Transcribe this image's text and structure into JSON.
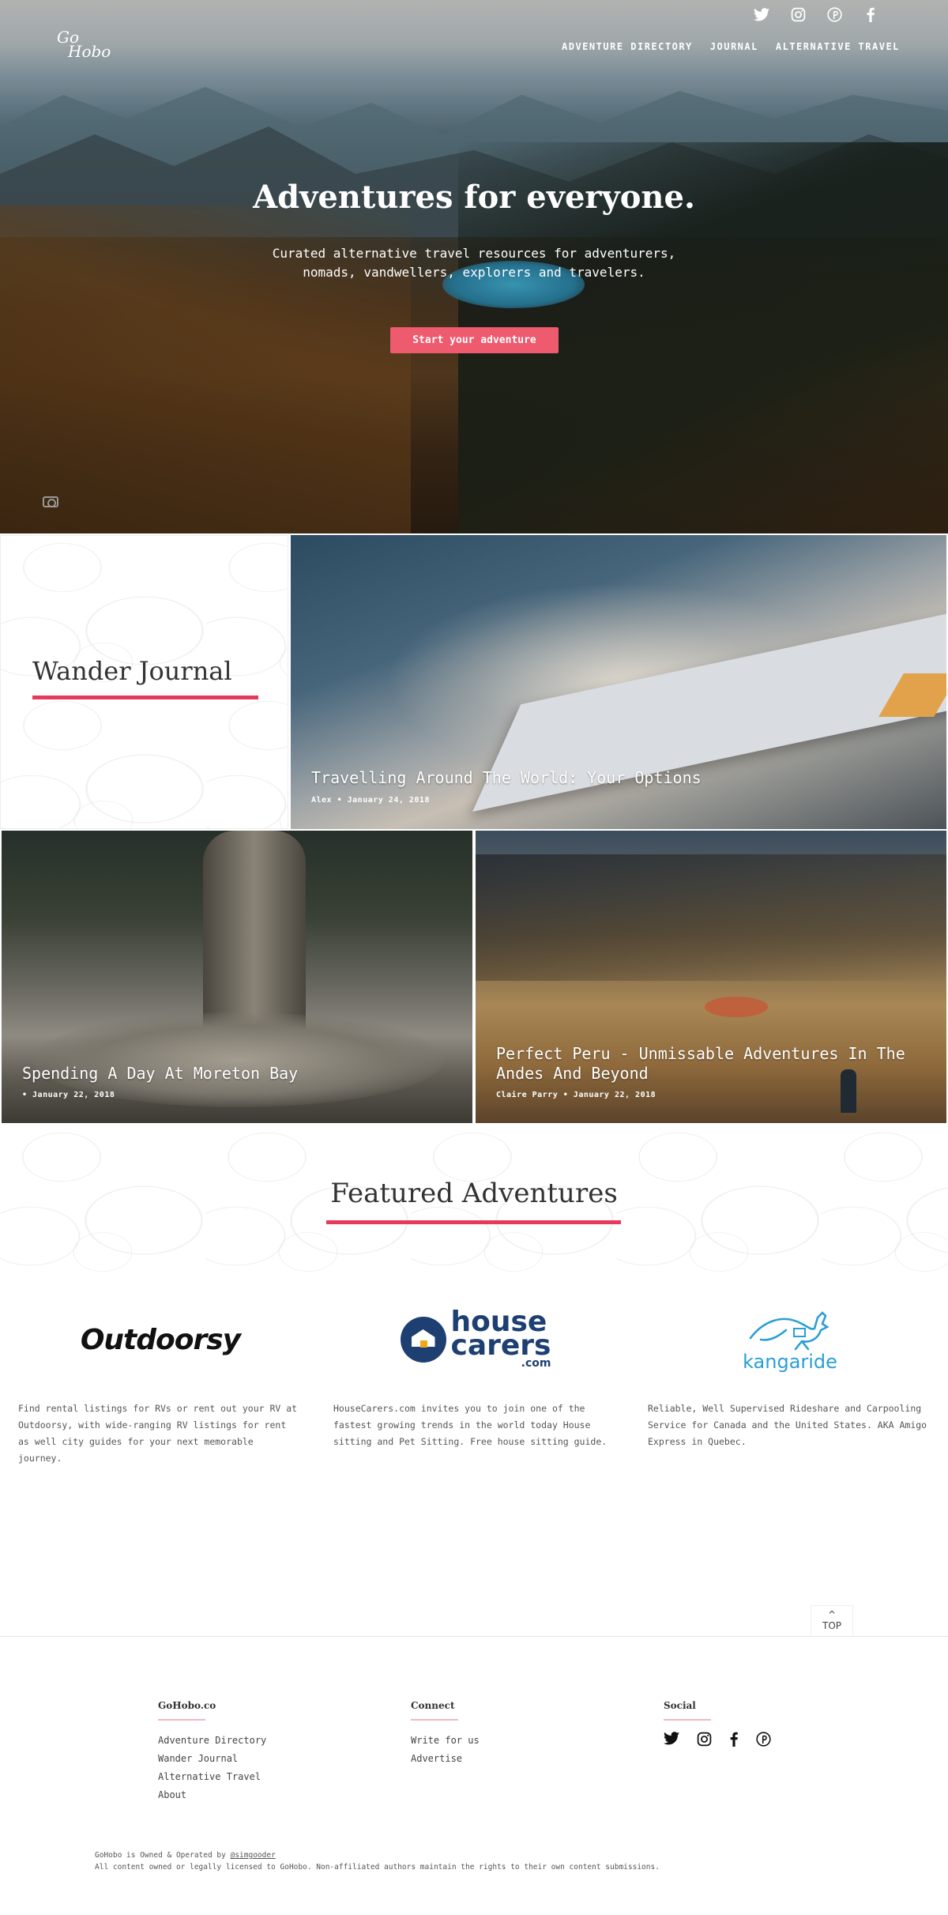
{
  "header": {
    "logo_line1": "Go",
    "logo_line2": "Hobo",
    "social_icons": [
      "twitter-icon",
      "instagram-icon",
      "pinterest-icon",
      "facebook-icon"
    ],
    "nav": [
      "ADVENTURE DIRECTORY",
      "JOURNAL",
      "ALTERNATIVE TRAVEL"
    ]
  },
  "hero": {
    "title": "Adventures for everyone.",
    "subtitle": "Curated alternative travel resources for adventurers, nomads, vandwellers, explorers and travelers.",
    "cta": "Start your adventure"
  },
  "journal": {
    "heading": "Wander Journal",
    "posts": [
      {
        "title": "Travelling Around The World: Your Options",
        "meta": "Alex • January 24, 2018"
      },
      {
        "title": "Spending A Day At Moreton Bay",
        "meta": "• January 22, 2018"
      },
      {
        "title": "Perfect Peru - Unmissable Adventures In The Andes And Beyond",
        "meta": "Claire Parry • January 22, 2018"
      }
    ]
  },
  "featured": {
    "heading": "Featured Adventures",
    "partners": [
      {
        "logo": "Outdoorsy",
        "desc": "Find rental listings for RVs or rent out your RV at Outdoorsy, with wide-ranging RV listings for rent as well city guides for your next memorable journey."
      },
      {
        "logo_a": "house",
        "logo_b": "carers",
        "logo_c": ".com",
        "desc": "HouseCarers.com invites you to join one of the fastest growing trends in the world today House sitting and Pet Sitting. Free house sitting guide."
      },
      {
        "logo": "kangaride",
        "desc": "Reliable, Well Supervised Rideshare and Carpooling Service for Canada and the United States. AKA Amigo Express in Quebec."
      }
    ]
  },
  "top_button": {
    "arrow": "^",
    "label": "TOP"
  },
  "footer": {
    "col1": {
      "title": "GoHobo.co",
      "links": [
        "Adventure Directory",
        "Wander Journal",
        "Alternative Travel",
        "About"
      ]
    },
    "col2": {
      "title": "Connect",
      "links": [
        "Write for us",
        "Advertise"
      ]
    },
    "col3": {
      "title": "Social",
      "icons": [
        "twitter-icon",
        "instagram-icon",
        "facebook-icon",
        "pinterest-icon"
      ]
    },
    "owned_prefix": "GoHobo is Owned & Operated by ",
    "owner": "@simgooder",
    "rights": "All content owned or legally licensed to GoHobo. Non-affiliated authors maintain the rights to their own content submissions."
  },
  "colors": {
    "accent": "#e63a5a",
    "cta": "#ee5a6e",
    "kangaride": "#2a9fd6",
    "housecarers": "#1d3f72"
  }
}
